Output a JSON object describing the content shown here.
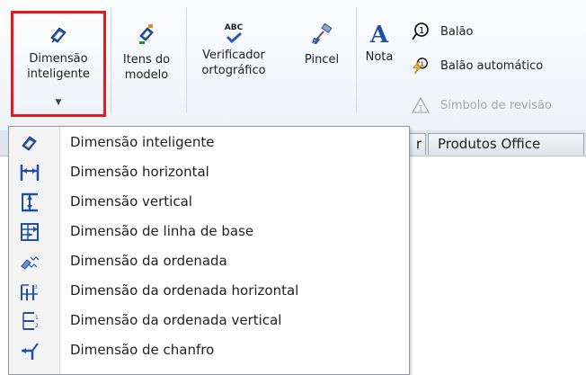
{
  "ribbon": {
    "smart_dimension": {
      "label": "Dimensão\ninteligente",
      "icon": "smart-dimension-icon"
    },
    "model_items": {
      "label": "Itens do\nmodelo",
      "icon": "model-items-icon"
    },
    "spell_checker": {
      "label": "Verificador\nortográfico",
      "icon": "spell-check-icon",
      "icon_text": "ABC"
    },
    "format_painter": {
      "label": "Pincel",
      "icon": "format-painter-icon"
    },
    "note": {
      "label": "Nota",
      "icon": "note-icon",
      "icon_text": "A"
    },
    "balloon": {
      "label": "Balão",
      "icon": "balloon-icon"
    },
    "auto_balloon": {
      "label": "Balão automático",
      "icon": "auto-balloon-icon"
    },
    "revision_symbol": {
      "label": "Símbolo de revisão",
      "icon": "revision-symbol-icon",
      "enabled": false
    }
  },
  "tabs": {
    "partial_tab": "r",
    "office_products": "Produtos Office"
  },
  "dropdown": {
    "items": [
      {
        "label": "Dimensão inteligente",
        "icon": "smart-dimension-icon"
      },
      {
        "label": "Dimensão horizontal",
        "icon": "horizontal-dimension-icon"
      },
      {
        "label": "Dimensão vertical",
        "icon": "vertical-dimension-icon"
      },
      {
        "label": "Dimensão de linha de base",
        "icon": "baseline-dimension-icon"
      },
      {
        "label": "Dimensão da ordenada",
        "icon": "ordinate-dimension-icon"
      },
      {
        "label": "Dimensão da ordenada horizontal",
        "icon": "horizontal-ordinate-icon"
      },
      {
        "label": "Dimensão da ordenada vertical",
        "icon": "vertical-ordinate-icon"
      },
      {
        "label": "Dimensão de chanfro",
        "icon": "chamfer-dimension-icon"
      }
    ]
  },
  "colors": {
    "highlight_border": "#e31b1b",
    "icon_blue": "#1f4fa8",
    "disabled_text": "#a8a8a8"
  }
}
